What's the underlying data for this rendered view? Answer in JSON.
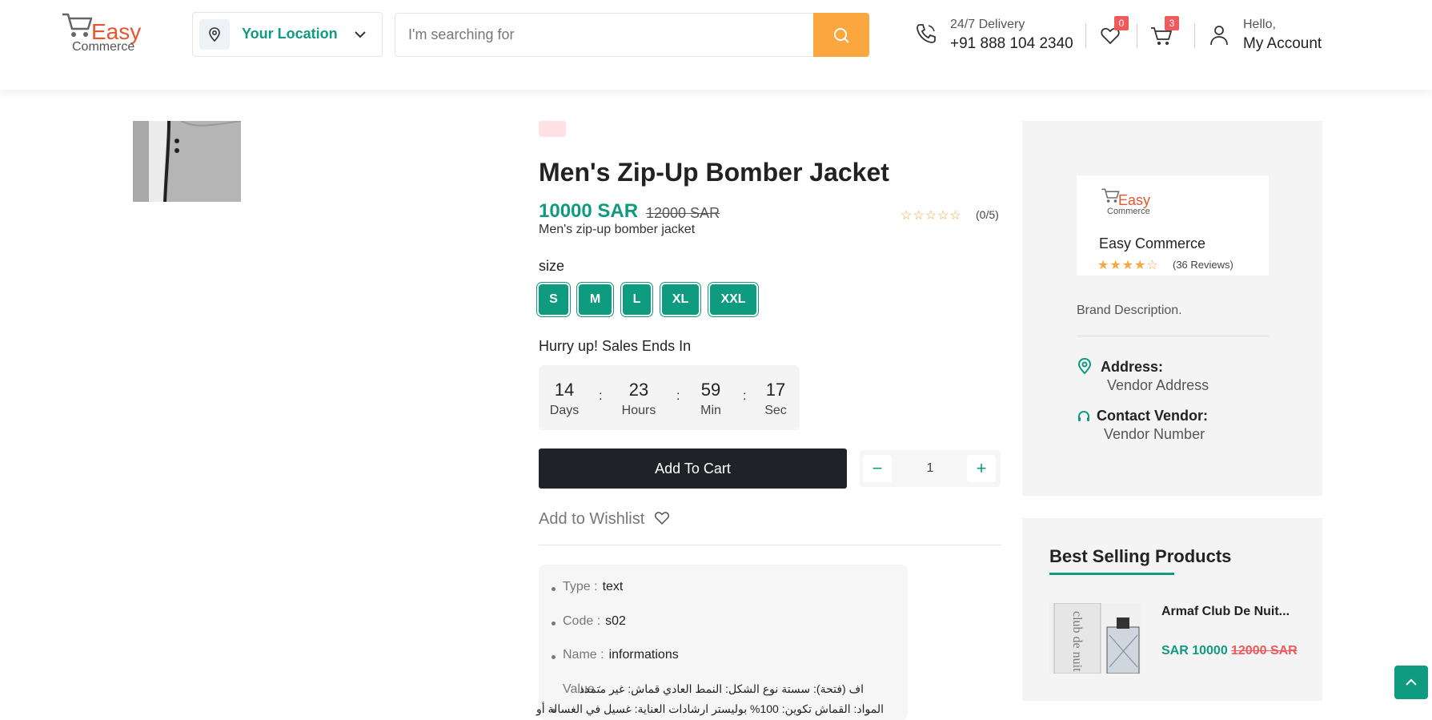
{
  "header": {
    "logo_top": "Easy",
    "logo_bottom": "Commerce",
    "location_label": "Your Location",
    "search_placeholder": "I'm searching for",
    "delivery_label": "24/7 Delivery",
    "delivery_phone": "+91 888 104 2340",
    "wishlist_count": "0",
    "cart_count": "3",
    "account_greeting": "Hello,",
    "account_label": "My Account"
  },
  "product": {
    "title": "Men's Zip-Up Bomber Jacket",
    "price": "10000 SAR",
    "old_price": "12000 SAR",
    "rating_text": "(0/5)",
    "rating_value": 0,
    "short_description": "Men's zip-up bomber jacket",
    "size_label": "size",
    "sizes": [
      "S",
      "M",
      "L",
      "XL",
      "XXL"
    ],
    "sale_heading": "Hurry up! Sales Ends In",
    "countdown": {
      "days": "14",
      "days_label": "Days",
      "hours": "23",
      "hours_label": "Hours",
      "minutes": "59",
      "minutes_label": "Min",
      "seconds": "17",
      "seconds_label": "Sec"
    },
    "add_to_cart_label": "Add To Cart",
    "quantity": "1",
    "wishlist_label": "Add to Wishlist",
    "attributes": {
      "type_label": "Type :",
      "type_value": "text",
      "code_label": "Code :",
      "code_value": "s02",
      "name_label": "Name :",
      "name_value": "informations",
      "value_label": "Value :",
      "value_line1": "اف (فتحة): سستة نوع الشكل: النمط العادي قماش: غير متمدد",
      "value_line2": "المواد: القماش تكوين: 100% بوليستر ارشادات العناية: غسيل في الغسالة أو"
    }
  },
  "vendor": {
    "logo_top": "Easy",
    "logo_bottom": "Commerce",
    "name": "Easy Commerce",
    "reviews": "(36 Reviews)",
    "rating_value": 4,
    "brand_description": "Brand Description.",
    "address_label": "Address:",
    "address_value": "Vendor Address",
    "contact_label": "Contact Vendor:",
    "contact_value": "Vendor Number"
  },
  "best_selling": {
    "title": "Best Selling Products",
    "items": [
      {
        "name": "Armaf Club De Nuit...",
        "price": "SAR 10000",
        "old_price": "12000 SAR"
      }
    ]
  },
  "colors": {
    "accent": "#0f9b7f",
    "orange": "#f9a73e",
    "red": "#f05a5a",
    "dark": "#1f2328"
  }
}
